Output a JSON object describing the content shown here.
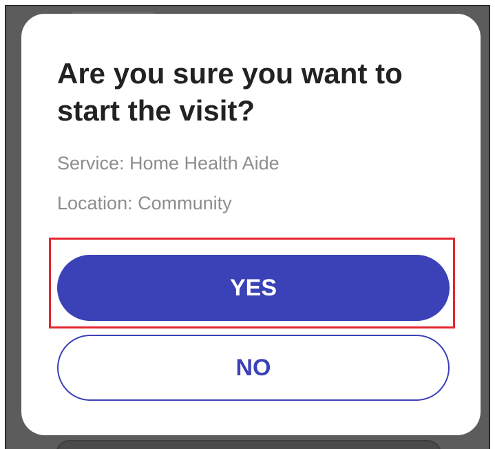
{
  "dialog": {
    "title": "Are you sure you want to start the visit?",
    "service": "Service: Home Health Aide",
    "location": "Location: Community",
    "yes_label": "YES",
    "no_label": "NO"
  },
  "colors": {
    "primary": "#3b41b6",
    "highlight": "#e2262f",
    "detail_text": "#8d8d8d",
    "title_text": "#222222"
  }
}
